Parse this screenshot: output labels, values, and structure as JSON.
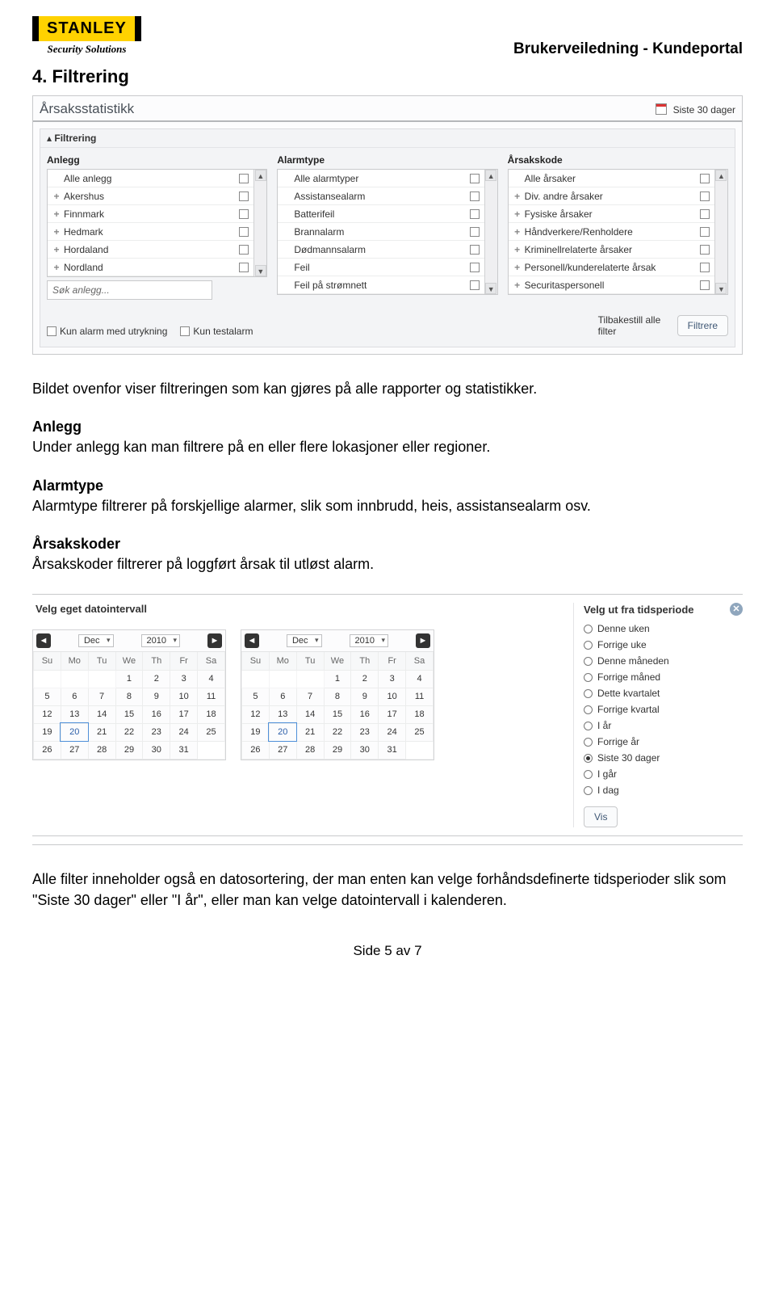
{
  "brand": {
    "name": "STANLEY",
    "sub": "Security Solutions"
  },
  "header_title": "Brukerveiledning - Kundeportal",
  "section_title": "4. Filtrering",
  "stats": {
    "title": "Årsaksstatistikk",
    "period_label": "Siste 30 dager",
    "filter_label": "Filtrering",
    "cols": {
      "anlegg": {
        "title": "Anlegg",
        "items": [
          "Alle anlegg",
          "Akershus",
          "Finnmark",
          "Hedmark",
          "Hordaland",
          "Nordland"
        ],
        "expand": [
          false,
          true,
          true,
          true,
          true,
          true
        ],
        "search": "Søk anlegg..."
      },
      "alarmtype": {
        "title": "Alarmtype",
        "items": [
          "Alle alarmtyper",
          "Assistansealarm",
          "Batterifeil",
          "Brannalarm",
          "Dødmannsalarm",
          "Feil",
          "Feil på strømnett"
        ],
        "expand": [
          false,
          false,
          false,
          false,
          false,
          false,
          false
        ]
      },
      "arsak": {
        "title": "Årsakskode",
        "items": [
          "Alle årsaker",
          "Div. andre årsaker",
          "Fysiske årsaker",
          "Håndverkere/Renholdere",
          "Kriminellrelaterte årsaker",
          "Personell/kunderelaterte årsak",
          "Securitaspersonell"
        ],
        "expand": [
          false,
          true,
          true,
          true,
          true,
          true,
          true
        ]
      }
    },
    "chk1": "Kun alarm med utrykning",
    "chk2": "Kun testalarm",
    "reset": "Tilbakestill alle filter",
    "apply": "Filtrere"
  },
  "prose": {
    "p1": "Bildet ovenfor viser filtreringen som kan gjøres på alle rapporter og statistikker.",
    "h2": "Anlegg",
    "p2": "Under anlegg kan man filtrere på en eller flere lokasjoner eller regioner.",
    "h3": "Alarmtype",
    "p3": "Alarmtype filtrerer på forskjellige alarmer, slik som innbrudd, heis, assistansealarm osv.",
    "h4": "Årsakskoder",
    "p4": "Årsakskoder filtrerer på loggført årsak til utløst alarm."
  },
  "date": {
    "left_title": "Velg eget datointervall",
    "right_title": "Velg ut fra tidsperiode",
    "month": "Dec",
    "year": "2010",
    "dows": [
      "Su",
      "Mo",
      "Tu",
      "We",
      "Th",
      "Fr",
      "Sa"
    ],
    "grid": [
      [
        "",
        "",
        "",
        "1",
        "2",
        "3",
        "4"
      ],
      [
        "5",
        "6",
        "7",
        "8",
        "9",
        "10",
        "11"
      ],
      [
        "12",
        "13",
        "14",
        "15",
        "16",
        "17",
        "18"
      ],
      [
        "19",
        "20",
        "21",
        "22",
        "23",
        "24",
        "25"
      ],
      [
        "26",
        "27",
        "28",
        "29",
        "30",
        "31",
        ""
      ]
    ],
    "selected_day": "20",
    "periods": [
      "Denne uken",
      "Forrige uke",
      "Denne måneden",
      "Forrige måned",
      "Dette kvartalet",
      "Forrige kvartal",
      "I år",
      "Forrige år",
      "Siste 30 dager",
      "I går",
      "I dag"
    ],
    "periods_active": "Siste 30 dager",
    "vis": "Vis"
  },
  "prose2": "Alle filter inneholder også en datosortering, der man enten kan velge forhåndsdefinerte tidsperioder slik som \"Siste 30 dager\" eller \"I år\", eller man kan velge datointervall i kalenderen.",
  "footer": "Side 5 av 7"
}
